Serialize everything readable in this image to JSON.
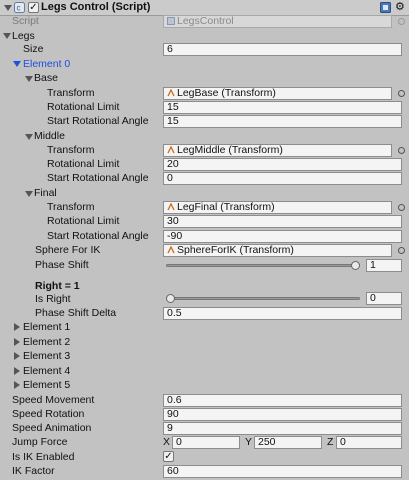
{
  "header": {
    "title": "Legs Control (Script)",
    "enabled": true,
    "script_label": "Script",
    "script_value": "LegsControl"
  },
  "legs": {
    "label": "Legs",
    "size_label": "Size",
    "size_value": "6",
    "element0_label": "Element 0",
    "base": {
      "label": "Base",
      "transform_label": "Transform",
      "transform_value": "LegBase (Transform)",
      "rot_limit_label": "Rotational Limit",
      "rot_limit_value": "15",
      "start_angle_label": "Start Rotational Angle",
      "start_angle_value": "15"
    },
    "middle": {
      "label": "Middle",
      "transform_label": "Transform",
      "transform_value": "LegMiddle (Transform)",
      "rot_limit_label": "Rotational Limit",
      "rot_limit_value": "20",
      "start_angle_label": "Start Rotational Angle",
      "start_angle_value": "0"
    },
    "final": {
      "label": "Final",
      "transform_label": "Transform",
      "transform_value": "LegFinal (Transform)",
      "rot_limit_label": "Rotational Limit",
      "rot_limit_value": "30",
      "start_angle_label": "Start Rotational Angle",
      "start_angle_value": "-90"
    },
    "sphere_label": "Sphere For IK",
    "sphere_value": "SphereForIK (Transform)",
    "phase_shift_label": "Phase Shift",
    "phase_shift_value": "1",
    "phase_shift_fraction": 1.0,
    "right_header": "Right = 1",
    "is_right_label": "Is Right",
    "is_right_value": "0",
    "is_right_fraction": 0.0,
    "phase_delta_label": "Phase Shift Delta",
    "phase_delta_value": "0.5",
    "elements": [
      "Element 1",
      "Element 2",
      "Element 3",
      "Element 4",
      "Element 5"
    ]
  },
  "settings": {
    "speed_movement_label": "Speed Movement",
    "speed_movement_value": "0.6",
    "speed_rotation_label": "Speed Rotation",
    "speed_rotation_value": "90",
    "speed_animation_label": "Speed Animation",
    "speed_animation_value": "9",
    "jump_force_label": "Jump Force",
    "jump_x_label": "X",
    "jump_x_value": "0",
    "jump_y_label": "Y",
    "jump_y_value": "250",
    "jump_z_label": "Z",
    "jump_z_value": "0",
    "ik_enabled_label": "Is IK Enabled",
    "ik_enabled": true,
    "ik_factor_label": "IK Factor",
    "ik_factor_value": "60"
  },
  "colors": {
    "background": "#c2c2c2",
    "field": "#f4f4f4",
    "element_highlight": "#1f4fe0"
  },
  "icons": [
    "foldout-arrow-icon",
    "script-icon",
    "checkbox-icon",
    "book-help-icon",
    "gear-icon",
    "transform-icon",
    "object-picker-icon"
  ]
}
